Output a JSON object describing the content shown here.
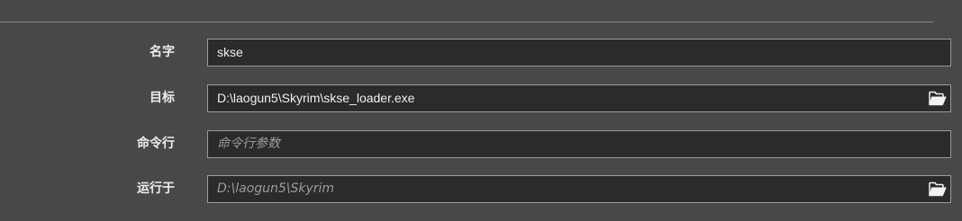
{
  "form": {
    "name": {
      "label": "名字",
      "value": "skse"
    },
    "target": {
      "label": "目标",
      "value": "D:\\laogun5\\Skyrim\\skse_loader.exe",
      "browse_icon": "folder-open-icon"
    },
    "arguments": {
      "label": "命令行",
      "value": "",
      "placeholder": "命令行参数"
    },
    "start_in": {
      "label": "运行于",
      "value": "",
      "placeholder": "D:\\laogun5\\Skyrim",
      "browse_icon": "folder-open-icon"
    }
  },
  "colors": {
    "background": "#484848",
    "field_background": "#2a2b2a",
    "field_border": "#9a9a9a",
    "text": "#f0f0f0",
    "placeholder": "#9c9c9c"
  }
}
